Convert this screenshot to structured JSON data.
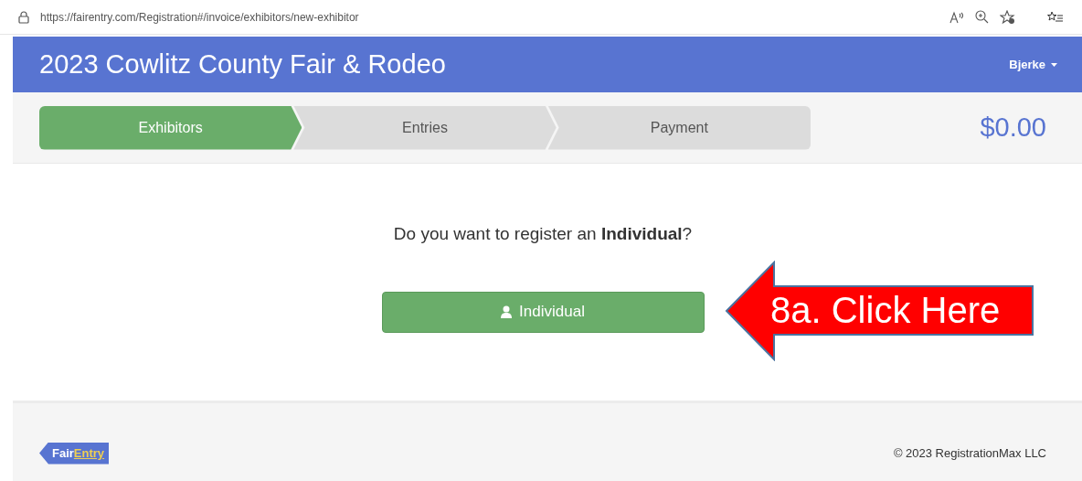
{
  "browser": {
    "url": "https://fairentry.com/Registration#/invoice/exhibitors/new-exhibitor"
  },
  "header": {
    "title": "2023 Cowlitz County Fair & Rodeo",
    "user": "Bjerke"
  },
  "steps": [
    {
      "label": "Exhibitors",
      "selected": true
    },
    {
      "label": "Entries",
      "selected": false
    },
    {
      "label": "Payment",
      "selected": false
    }
  ],
  "total": "$0.00",
  "question": "Do you want to register an **Individual**?",
  "individual_button": "Individual",
  "callout": "8a. Click Here",
  "footer": {
    "logo_left": "Fair",
    "logo_right": "Entry",
    "copyright": "© 2023 RegistrationMax LLC"
  }
}
